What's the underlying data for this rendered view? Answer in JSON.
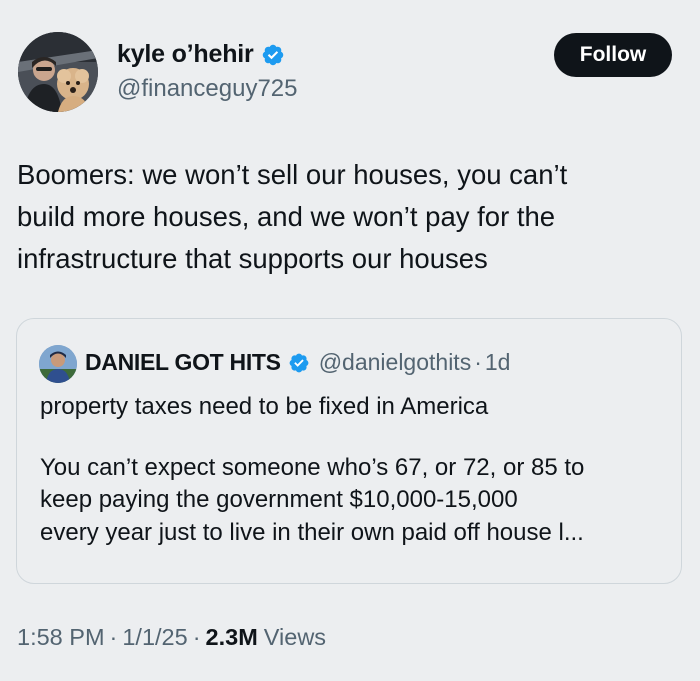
{
  "author": {
    "name": "kyle o’hehir",
    "handle": "@financeguy725",
    "verified": true,
    "avatar_icon": "user-avatar-with-dog"
  },
  "follow_label": "Follow",
  "tweet": {
    "lines": [
      "Boomers: we won’t sell our houses, you can’t",
      "build more houses, and we won’t pay for the",
      "infrastructure that supports our houses"
    ]
  },
  "quote": {
    "name": "DANIEL GOT HITS",
    "handle": "@danielgothits",
    "separator": "·",
    "time": "1d",
    "verified": true,
    "line1": "property taxes need to be fixed in America",
    "paragraph2": [
      "You can’t expect someone who’s 67, or 72, or 85 to",
      "keep paying the government $10,000-15,000",
      "every year just to live in their own paid off house l..."
    ]
  },
  "meta": {
    "time": "1:58 PM",
    "sep": "·",
    "date": "1/1/25",
    "views_count": "2.3M",
    "views_label": "Views"
  },
  "colors": {
    "background": "#eceef0",
    "text": "#0f1419",
    "secondary": "#536471",
    "verified": "#1d9bf0",
    "follow_bg": "#0f1419"
  }
}
